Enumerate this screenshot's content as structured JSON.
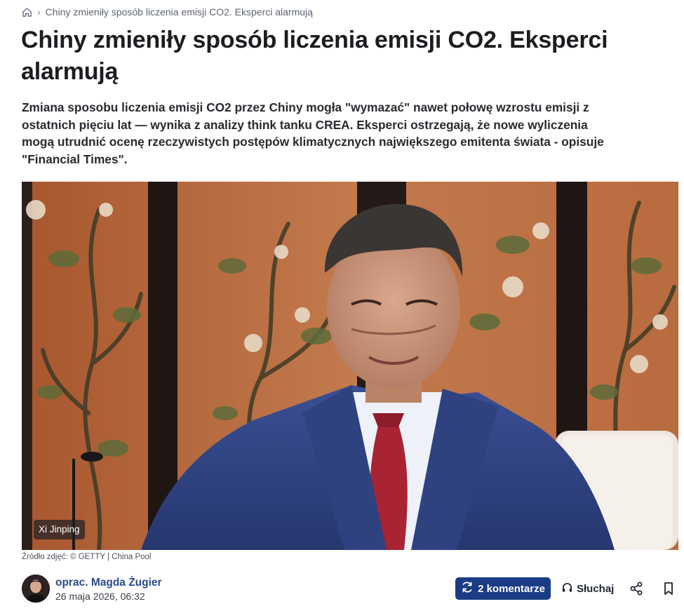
{
  "breadcrumb": {
    "home_icon": "home-icon",
    "separator": "›",
    "current": "Chiny zmieniły sposób liczenia emisji CO2. Eksperci alarmują"
  },
  "article": {
    "title": "Chiny zmieniły sposób liczenia emisji CO2. Eksperci alarmują",
    "lead": "Zmiana sposobu liczenia emisji CO2 przez Chiny mogła \"wymazać\" nawet połowę wzrostu emisji z ostatnich pięciu lat — wynika z analizy think tanku CREA. Eksperci ostrzegają, że nowe wyliczenia mogą utrudnić ocenę rzeczywistych postępów klimatycznych największego emitenta świata - opisuje \"Financial Times\"."
  },
  "photo": {
    "caption_tag": "Xi Jinping",
    "source": "Źródło zdjęć: © GETTY | China Pool"
  },
  "author": {
    "name": "oprac. Magda Żugier",
    "date": "26 maja 2026, 06:32"
  },
  "actions": {
    "comments_label": "2 komentarze",
    "listen_label": "Słuchaj",
    "share_icon": "share-icon",
    "bookmark_icon": "bookmark-icon"
  },
  "colors": {
    "accent": "#1a3c85",
    "author_link": "#2b4a8a",
    "title": "#1c1c21"
  }
}
